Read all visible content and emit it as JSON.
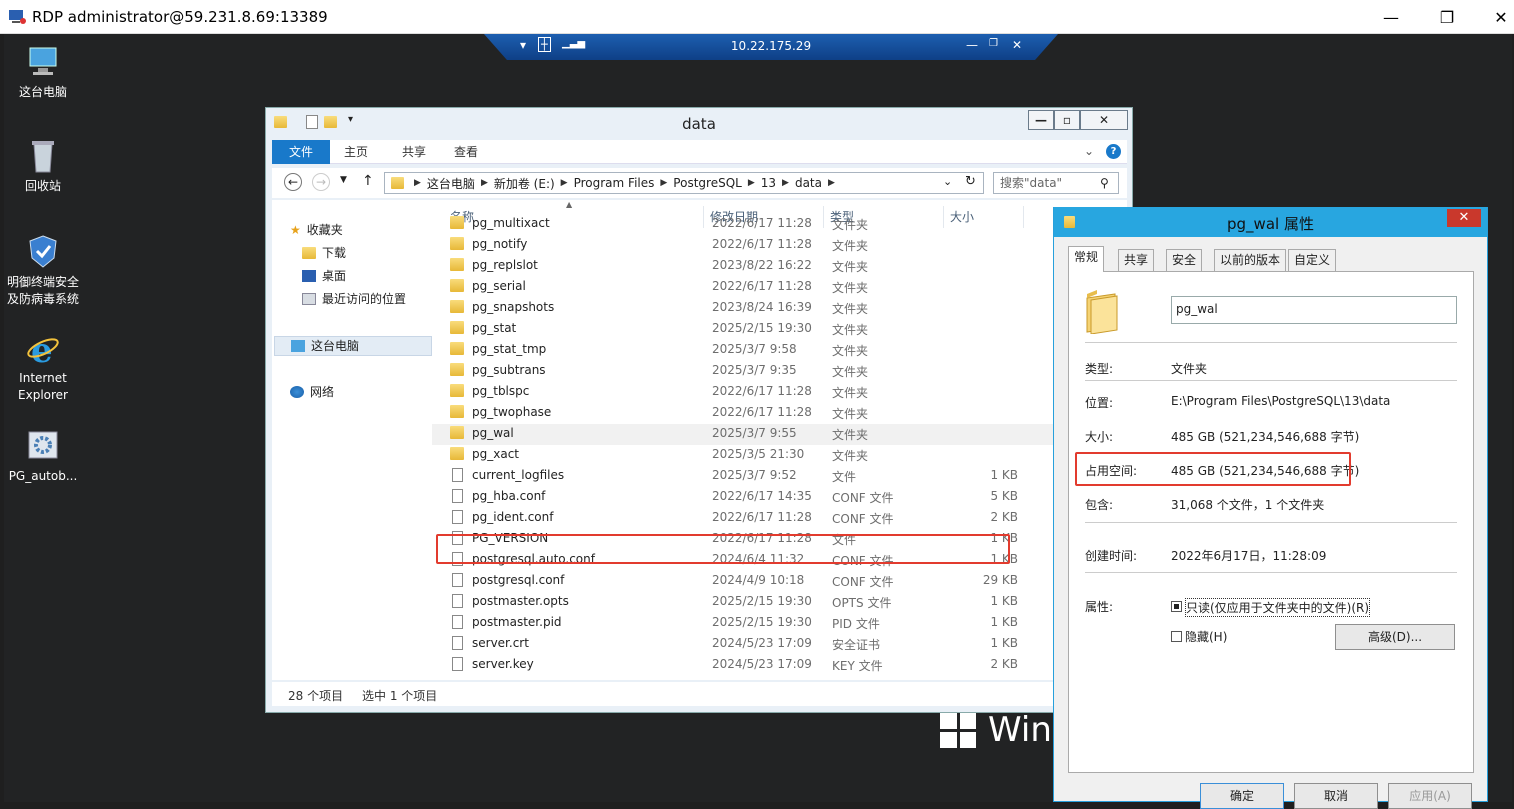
{
  "rdp": {
    "title": "RDP  administrator@59.231.8.69:13389",
    "connection_ip": "10.22.175.29",
    "controls": {
      "minimize": "—",
      "restore": "❐",
      "close": "✕"
    }
  },
  "desktop": {
    "icons": [
      {
        "label": "这台电脑",
        "icon": "computer-icon"
      },
      {
        "label": "回收站",
        "icon": "recycle-bin-icon"
      },
      {
        "label": "明御终端安全及防病毒系统",
        "icon": "shield-icon"
      },
      {
        "label": "Internet Explorer",
        "icon": "ie-icon"
      },
      {
        "label": "PG_autob...",
        "icon": "gear-app-icon"
      }
    ],
    "watermark": "Winc"
  },
  "explorer": {
    "title": "data",
    "ribbon_tabs": [
      "文件",
      "主页",
      "共享",
      "查看"
    ],
    "breadcrumb": [
      "这台电脑",
      "新加卷 (E:)",
      "Program Files",
      "PostgreSQL",
      "13",
      "data"
    ],
    "search_placeholder": "搜索\"data\"",
    "nav": {
      "favorites": "收藏夹",
      "downloads": "下载",
      "desktop": "桌面",
      "recent": "最近访问的位置",
      "this_pc": "这台电脑",
      "network": "网络"
    },
    "columns": {
      "name": "名称",
      "date": "修改日期",
      "type": "类型",
      "size": "大小"
    },
    "files": [
      {
        "name": "pg_multixact",
        "date": "2022/6/17 11:28",
        "type": "文件夹",
        "size": "",
        "kind": "folder"
      },
      {
        "name": "pg_notify",
        "date": "2022/6/17 11:28",
        "type": "文件夹",
        "size": "",
        "kind": "folder"
      },
      {
        "name": "pg_replslot",
        "date": "2023/8/22 16:22",
        "type": "文件夹",
        "size": "",
        "kind": "folder"
      },
      {
        "name": "pg_serial",
        "date": "2022/6/17 11:28",
        "type": "文件夹",
        "size": "",
        "kind": "folder"
      },
      {
        "name": "pg_snapshots",
        "date": "2023/8/24 16:39",
        "type": "文件夹",
        "size": "",
        "kind": "folder"
      },
      {
        "name": "pg_stat",
        "date": "2025/2/15 19:30",
        "type": "文件夹",
        "size": "",
        "kind": "folder"
      },
      {
        "name": "pg_stat_tmp",
        "date": "2025/3/7 9:58",
        "type": "文件夹",
        "size": "",
        "kind": "folder"
      },
      {
        "name": "pg_subtrans",
        "date": "2025/3/7 9:35",
        "type": "文件夹",
        "size": "",
        "kind": "folder"
      },
      {
        "name": "pg_tblspc",
        "date": "2022/6/17 11:28",
        "type": "文件夹",
        "size": "",
        "kind": "folder"
      },
      {
        "name": "pg_twophase",
        "date": "2022/6/17 11:28",
        "type": "文件夹",
        "size": "",
        "kind": "folder"
      },
      {
        "name": "pg_wal",
        "date": "2025/3/7 9:55",
        "type": "文件夹",
        "size": "",
        "kind": "folder"
      },
      {
        "name": "pg_xact",
        "date": "2025/3/5 21:30",
        "type": "文件夹",
        "size": "",
        "kind": "folder"
      },
      {
        "name": "current_logfiles",
        "date": "2025/3/7 9:52",
        "type": "文件",
        "size": "1 KB",
        "kind": "file"
      },
      {
        "name": "pg_hba.conf",
        "date": "2022/6/17 14:35",
        "type": "CONF 文件",
        "size": "5 KB",
        "kind": "file"
      },
      {
        "name": "pg_ident.conf",
        "date": "2022/6/17 11:28",
        "type": "CONF 文件",
        "size": "2 KB",
        "kind": "file"
      },
      {
        "name": "PG_VERSION",
        "date": "2022/6/17 11:28",
        "type": "文件",
        "size": "1 KB",
        "kind": "file"
      },
      {
        "name": "postgresql.auto.conf",
        "date": "2024/6/4 11:32",
        "type": "CONF 文件",
        "size": "1 KB",
        "kind": "file"
      },
      {
        "name": "postgresql.conf",
        "date": "2024/4/9 10:18",
        "type": "CONF 文件",
        "size": "29 KB",
        "kind": "file"
      },
      {
        "name": "postmaster.opts",
        "date": "2025/2/15 19:30",
        "type": "OPTS 文件",
        "size": "1 KB",
        "kind": "file"
      },
      {
        "name": "postmaster.pid",
        "date": "2025/2/15 19:30",
        "type": "PID 文件",
        "size": "1 KB",
        "kind": "file"
      },
      {
        "name": "server.crt",
        "date": "2024/5/23 17:09",
        "type": "安全证书",
        "size": "1 KB",
        "kind": "cert"
      },
      {
        "name": "server.key",
        "date": "2024/5/23 17:09",
        "type": "KEY 文件",
        "size": "2 KB",
        "kind": "file"
      }
    ],
    "status": {
      "count": "28 个项目",
      "selected": "选中 1 个项目"
    }
  },
  "properties": {
    "title": "pg_wal 属性",
    "tabs": [
      "常规",
      "共享",
      "安全",
      "以前的版本",
      "自定义"
    ],
    "name_value": "pg_wal",
    "type_label": "类型:",
    "type_value": "文件夹",
    "location_label": "位置:",
    "location_value": "E:\\Program Files\\PostgreSQL\\13\\data",
    "size_label": "大小:",
    "size_value": "485 GB (521,234,546,688 字节)",
    "disk_label": "占用空间:",
    "disk_value": "485 GB (521,234,546,688 字节)",
    "contains_label": "包含:",
    "contains_value": "31,068 个文件，1 个文件夹",
    "created_label": "创建时间:",
    "created_value": "2022年6月17日，11:28:09",
    "attr_label": "属性:",
    "readonly_label": "只读(仅应用于文件夹中的文件)(R)",
    "hidden_label": "隐藏(H)",
    "advanced_button": "高级(D)...",
    "ok": "确定",
    "cancel": "取消",
    "apply": "应用(A)"
  },
  "colors": {
    "accent": "#1979ca",
    "highlight": "#e23b2e",
    "props_title": "#28a6e0"
  }
}
